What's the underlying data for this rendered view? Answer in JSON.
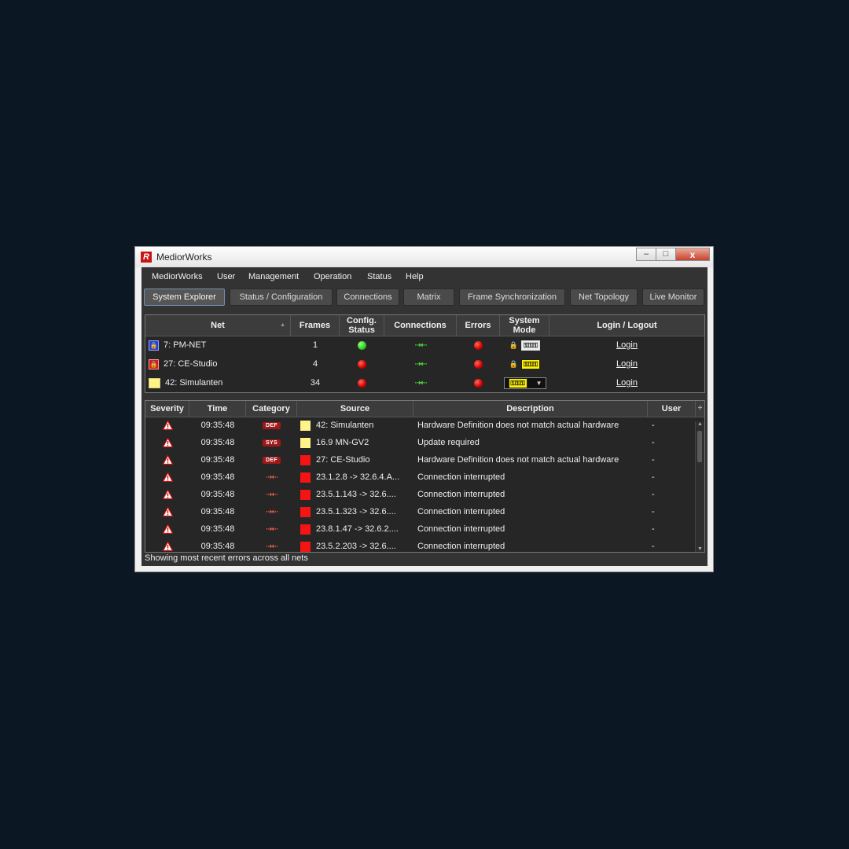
{
  "window": {
    "title": "MediorWorks",
    "logo_letter": "R"
  },
  "window_buttons": {
    "minimize": "–",
    "maximize": "□",
    "close": "x"
  },
  "menu": [
    "MediorWorks",
    "User",
    "Management",
    "Operation",
    "Status",
    "Help"
  ],
  "tabs": [
    "System Explorer",
    "Status / Configuration",
    "Connections",
    "Matrix",
    "Frame Synchronization",
    "Net Topology",
    "Live Monitor"
  ],
  "active_tab": "System Explorer",
  "net_table": {
    "headers": {
      "net": "Net",
      "sort_indicator": "▲",
      "frames": "Frames",
      "config_status": "Config. Status",
      "connections": "Connections",
      "errors": "Errors",
      "system_mode": "System Mode",
      "login": "Login / Logout"
    },
    "rows": [
      {
        "icon": "blue-lock-net-icon",
        "name": "7: PM-NET",
        "frames": "1",
        "config": "green",
        "connections_glyph": "⇢⇠",
        "errors": "red",
        "mode_glyph": "⚿⚿⚿",
        "locked": true,
        "login": "Login"
      },
      {
        "icon": "red-lock-net-icon",
        "name": "27: CE-Studio",
        "frames": "4",
        "config": "red",
        "connections_glyph": "⇢⇠",
        "errors": "red",
        "mode_glyph": "⚿⚿⚿",
        "locked": true,
        "login": "Login"
      },
      {
        "icon": "yellow-net-icon",
        "name": "42: Simulanten",
        "frames": "34",
        "config": "red",
        "connections_glyph": "⇢⇠",
        "errors": "red",
        "mode_glyph": "⚿⚿⚿",
        "locked": false,
        "login": "Login"
      }
    ]
  },
  "error_table": {
    "headers": {
      "severity": "Severity",
      "time": "Time",
      "category": "Category",
      "source": "Source",
      "description": "Description",
      "user": "User",
      "add": "+"
    },
    "rows": [
      {
        "time": "09:35:48",
        "category": "DEF",
        "source_color": "yellow",
        "source": "42: Simulanten",
        "description": "Hardware Definition does not match actual hardware",
        "user": "-"
      },
      {
        "time": "09:35:48",
        "category": "SYS",
        "source_color": "yellow",
        "source": "16.9 MN-GV2",
        "description": "Update required",
        "user": "-"
      },
      {
        "time": "09:35:48",
        "category": "DEF",
        "source_color": "red",
        "source": "27: CE-Studio",
        "description": "Hardware Definition does not match actual hardware",
        "user": "-"
      },
      {
        "time": "09:35:48",
        "category": "CONN",
        "source_color": "red",
        "source": "23.1.2.8 -> 32.6.4.A...",
        "description": "Connection interrupted",
        "user": "-"
      },
      {
        "time": "09:35:48",
        "category": "CONN",
        "source_color": "red",
        "source": "23.5.1.143 -> 32.6....",
        "description": "Connection interrupted",
        "user": "-"
      },
      {
        "time": "09:35:48",
        "category": "CONN",
        "source_color": "red",
        "source": "23.5.1.323 -> 32.6....",
        "description": "Connection interrupted",
        "user": "-"
      },
      {
        "time": "09:35:48",
        "category": "CONN",
        "source_color": "red",
        "source": "23.8.1.47 -> 32.6.2....",
        "description": "Connection interrupted",
        "user": "-"
      },
      {
        "time": "09:35:48",
        "category": "CONN",
        "source_color": "red",
        "source": "23.5.2.203 -> 32.6....",
        "description": "Connection interrupted",
        "user": "-"
      }
    ]
  },
  "status_bar": "Showing most recent errors across all nets"
}
